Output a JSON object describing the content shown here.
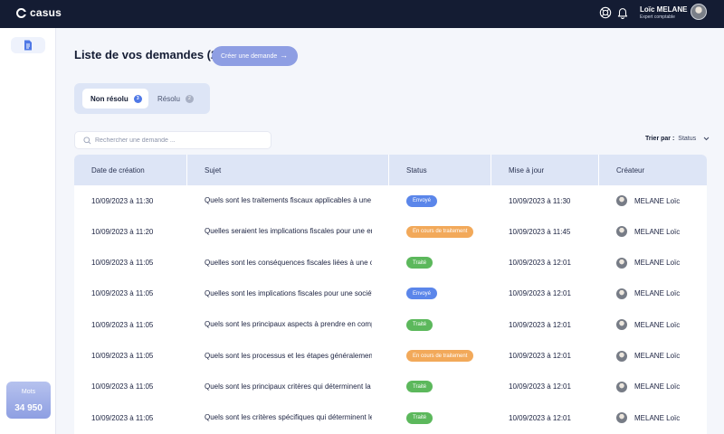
{
  "app": {
    "brand": "casus"
  },
  "user": {
    "name": "Loïc MELANE",
    "role": "Expert comptable"
  },
  "sidebar": {
    "mots_label": "Mots",
    "mots_value": "34 950"
  },
  "page": {
    "title": "Liste de vos demandes (29)",
    "create_label": "Créer une demande"
  },
  "tabs": [
    {
      "label": "Non résolu",
      "count": "3"
    },
    {
      "label": "Résolu",
      "count": "2"
    }
  ],
  "search": {
    "placeholder": "Rechercher une demande ..."
  },
  "sort": {
    "label": "Trier par :",
    "value": "Status"
  },
  "table": {
    "columns": [
      "Date de création",
      "Sujet",
      "Status",
      "Mise  à jour",
      "Créateur"
    ],
    "rows": [
      {
        "created": "10/09/2023 à 11:30",
        "subject": "Quels sont les traitements fiscaux applicables à une transaction",
        "status": "Envoyé",
        "status_kind": "blue",
        "updated": "10/09/2023 à 11:30",
        "creator": "MELANE Loïc"
      },
      {
        "created": "10/09/2023 à 11:20",
        "subject": "Quelles seraient les implications fiscales pour une entreprise",
        "status": "En cours de traitement",
        "status_kind": "orange",
        "updated": "10/09/2023 à 11:45",
        "creator": "MELANE Loïc"
      },
      {
        "created": "10/09/2023 à 11:05",
        "subject": "Quelles sont les conséquences fiscales liées à une opération",
        "status": "Traité",
        "status_kind": "green",
        "updated": "10/09/2023 à 12:01",
        "creator": "MELANE Loïc"
      },
      {
        "created": "10/09/2023 à 11:05",
        "subject": "Quelles sont les implications fiscales pour une société",
        "status": "Envoyé",
        "status_kind": "blue",
        "updated": "10/09/2023 à 12:01",
        "creator": "MELANE Loïc"
      },
      {
        "created": "10/09/2023 à 11:05",
        "subject": "Quels sont les principaux aspects à prendre en compte",
        "status": "Traité",
        "status_kind": "green",
        "updated": "10/09/2023 à 12:01",
        "creator": "MELANE Loïc"
      },
      {
        "created": "10/09/2023 à 11:05",
        "subject": "Quels sont les processus et les étapes généralement suivis",
        "status": "En cours de traitement",
        "status_kind": "orange",
        "updated": "10/09/2023 à 12:01",
        "creator": "MELANE Loïc"
      },
      {
        "created": "10/09/2023 à 11:05",
        "subject": "Quels sont les principaux critères qui déterminent la",
        "status": "Traité",
        "status_kind": "green",
        "updated": "10/09/2023 à 12:01",
        "creator": "MELANE Loïc"
      },
      {
        "created": "10/09/2023 à 11:05",
        "subject": "Quels sont les critères spécifiques qui déterminent le",
        "status": "Traité",
        "status_kind": "green",
        "updated": "10/09/2023 à 12:01",
        "creator": "MELANE Loïc"
      }
    ]
  },
  "colors": {
    "topbar": "#141c33",
    "accent": "#8e9ee3",
    "status_blue": "#5b86ea",
    "status_orange": "#f2a95a",
    "status_green": "#5cb85c"
  }
}
